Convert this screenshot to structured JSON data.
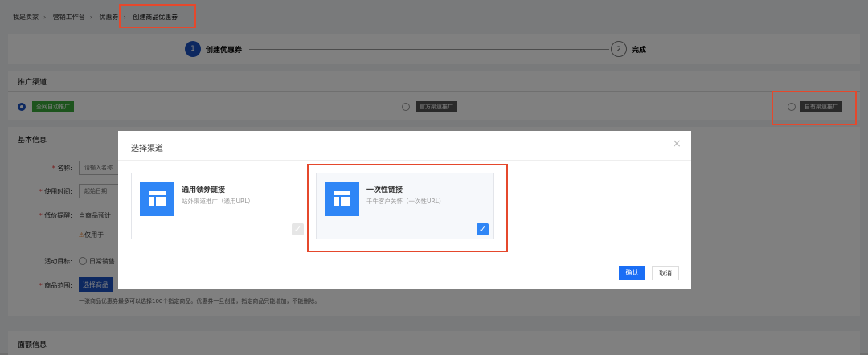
{
  "breadcrumb": [
    "我是卖家",
    "营销工作台",
    "优惠券",
    "创建商品优惠券"
  ],
  "steps": [
    {
      "num": "1",
      "label": "创建优惠券"
    },
    {
      "num": "2",
      "label": "完成"
    }
  ],
  "promo": {
    "title": "推广渠道",
    "options": [
      "全网自动推广",
      "官方渠道推广",
      "自有渠道推广"
    ]
  },
  "basic": {
    "title": "基本信息",
    "name_label": "名称:",
    "name_placeholder": "请输入名称",
    "time_label": "使用时间:",
    "time_placeholder": "起始日期",
    "low_label": "低价提醒:",
    "low_text": "当商品预计",
    "warn_text": "仅用于",
    "goal_label": "活动目标:",
    "goal_option": "日常销售",
    "scope_label": "商品范围:",
    "scope_button": "选择商品",
    "note": "一张商品优惠券最多可以选择100个指定商品。优惠券一旦创建，指定商品只能增加，不能删除。"
  },
  "denom": {
    "title": "面额信息"
  },
  "modal": {
    "title": "选择渠道",
    "close": "×",
    "cards": [
      {
        "title": "通用领券链接",
        "desc": "站外渠道推广（通用URL）",
        "checked": false
      },
      {
        "title": "一次性链接",
        "desc": "千牛客户关怀（一次性URL）",
        "checked": true
      }
    ],
    "confirm": "确认",
    "cancel": "取消"
  },
  "colors": {
    "primary": "#1a6ef5",
    "green": "#3aa83a",
    "highlight": "#e5482c"
  }
}
